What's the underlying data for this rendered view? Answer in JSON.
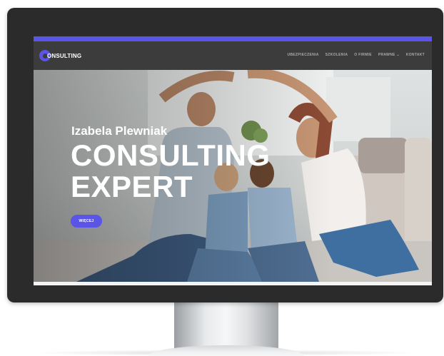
{
  "logo": {
    "text": "ONSULTING",
    "icon": "logo-c-icon"
  },
  "nav": {
    "items": [
      {
        "label": "UBEZPIECZENIA"
      },
      {
        "label": "SZKOLENIA"
      },
      {
        "label": "O FIRMIE"
      },
      {
        "label": "PRAWNE",
        "icon": "chevron-down-icon",
        "caret": "⌄"
      },
      {
        "label": "KONTAKT"
      }
    ]
  },
  "hero": {
    "subtitle": "Izabela Plewniak",
    "title_line1": "CONSULTING",
    "title_line2": "EXPERT",
    "button_label": "WIĘCEJ"
  },
  "colors": {
    "accent": "#5a55e6",
    "monitor_frame": "#2b2b2b",
    "nav_bg": "#3c3c3c",
    "nav_text": "#a9a9a9"
  }
}
